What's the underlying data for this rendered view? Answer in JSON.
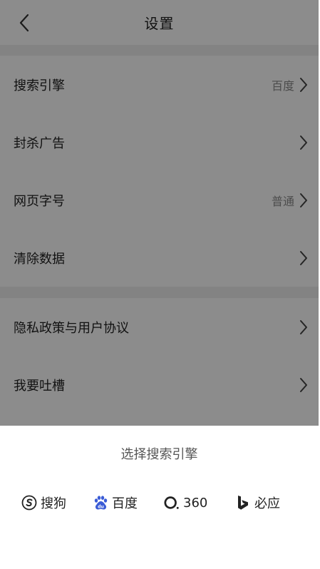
{
  "header": {
    "title": "设置"
  },
  "settings": {
    "items": [
      {
        "label": "搜索引擎",
        "value": "百度"
      },
      {
        "label": "封杀广告",
        "value": ""
      },
      {
        "label": "网页字号",
        "value": "普通"
      },
      {
        "label": "清除数据",
        "value": ""
      },
      {
        "label": "隐私政策与用户协议",
        "value": ""
      },
      {
        "label": "我要吐槽",
        "value": ""
      }
    ]
  },
  "sheet": {
    "title": "选择搜索引擎",
    "engines": [
      {
        "label": "搜狗",
        "icon": "sogou-icon"
      },
      {
        "label": "百度",
        "icon": "baidu-icon"
      },
      {
        "label": "360",
        "icon": "360-icon"
      },
      {
        "label": "必应",
        "icon": "bing-icon"
      }
    ]
  },
  "colors": {
    "baidu_blue": "#3b5cd6",
    "text": "#222222",
    "secondary_text": "#8a8a8a"
  }
}
